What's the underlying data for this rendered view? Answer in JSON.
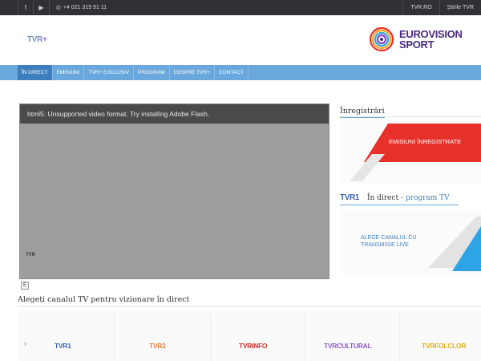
{
  "topbar": {
    "phone": "+4 021 319 91 11",
    "links": [
      "TVR.RO",
      "Știrile TVR"
    ]
  },
  "header": {
    "logo_text": "TVR",
    "logo_plus": "+",
    "partner_line1": "EUROVISION",
    "partner_line2": "SPORT"
  },
  "nav": {
    "items": [
      "În direct",
      "Emisiuni",
      "TVR+ Exclusiv",
      "Program",
      "Despre TVR+",
      "Contact"
    ]
  },
  "player": {
    "message": "html5: Unsupported video format. Try installing Adobe Flash.",
    "watermark": "TVR",
    "e_label": "E"
  },
  "sidebar": {
    "recordings_title": "Înregistrări",
    "recordings_button": "EMISIUNI ÎNREGISTRATE",
    "live_logo": "TVR1",
    "live_title": "În direct - ",
    "live_link": "program TV",
    "choose_channel": "ALEGE CANALUL CU TRANSMISIE LIVE"
  },
  "channels": {
    "title": "Alegeți canalul TV pentru vizionare în direct",
    "items": [
      "TVR1",
      "TVR2",
      "TVRINFO",
      "TVRCULTURAL",
      "TVRFOLCLOR"
    ]
  },
  "colors": {
    "nav": "#6aa7dc",
    "nav_active": "#3d7fbe",
    "accent_red": "#e8302a",
    "topbar": "#2f3136"
  }
}
